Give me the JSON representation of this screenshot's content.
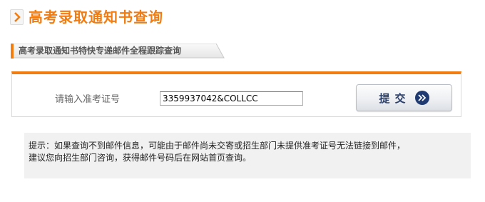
{
  "page": {
    "title": "高考录取通知书查询",
    "title_color": "#f07c12",
    "arrow_icon": "chevron-right-icon"
  },
  "sub_header": {
    "label": "高考录取通知书特快专递邮件全程跟踪查询"
  },
  "query_form": {
    "field_label": "请输入准考证号",
    "input_value": "3359937042&COLLCC",
    "submit_label": "提交",
    "submit_icon": "double-chevron-right-icon",
    "accent_color": "#f07c12"
  },
  "tip": {
    "line1": "提示：如果查询不到邮件信息，可能由于邮件尚未交寄或招生部门未提供准考证号无法链接到邮件，",
    "line2": "建议您向招生部门咨询，获得邮件号码后在网站首页查询。"
  }
}
